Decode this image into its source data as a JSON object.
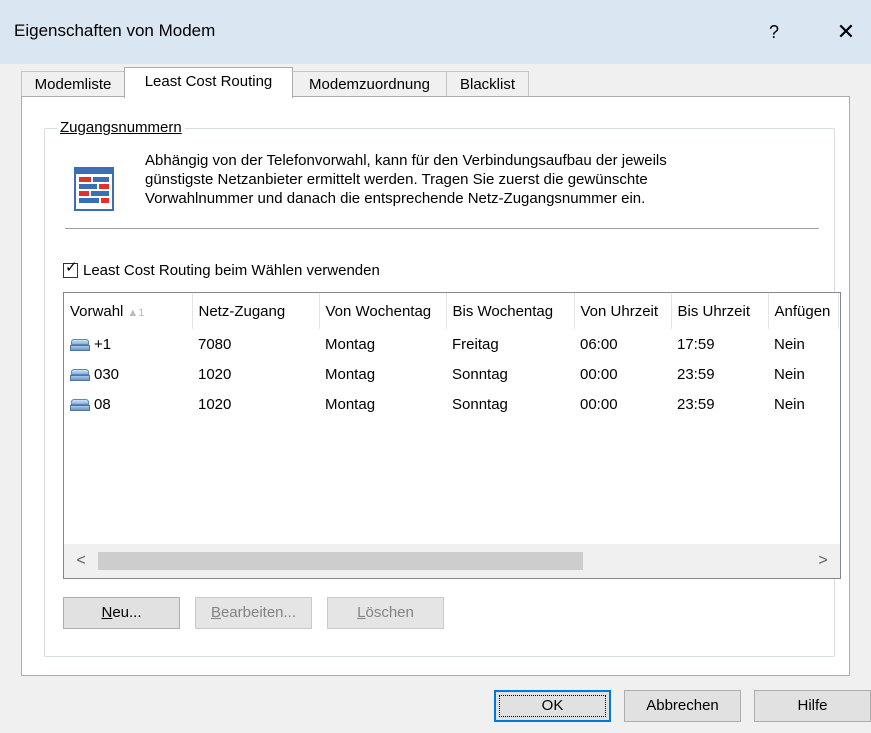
{
  "window": {
    "title": "Eigenschaften von Modem",
    "help_label": "?",
    "close_label": "✕"
  },
  "tabs": [
    {
      "label": "Modemliste",
      "active": false
    },
    {
      "label": "Least Cost Routing",
      "active": true
    },
    {
      "label": "Modemzuordnung",
      "active": false
    },
    {
      "label": "Blacklist",
      "active": false
    }
  ],
  "group": {
    "legend": "Zugangsnummern",
    "info_line1": "Abhängig von der Telefonvorwahl, kann für den Verbindungsaufbau der jeweils",
    "info_line2": "günstigste Netzanbieter ermittelt werden. Tragen Sie zuerst die gewünschte",
    "info_line3": "Vorwahlnummer und danach die entsprechende Netz-Zugangsnummer ein.",
    "checkbox_label": "Least Cost Routing beim Wählen verwenden",
    "checkbox_checked": true
  },
  "table": {
    "columns": [
      "Vorwahl",
      "Netz-Zugang",
      "Von Wochentag",
      "Bis Wochentag",
      "Von Uhrzeit",
      "Bis Uhrzeit",
      "Anfügen"
    ],
    "sort_indicator": "▲1",
    "rows": [
      [
        "+1",
        "7080",
        "Montag",
        "Freitag",
        "06:00",
        "17:59",
        "Nein"
      ],
      [
        "030",
        "1020",
        "Montag",
        "Sonntag",
        "00:00",
        "23:59",
        "Nein"
      ],
      [
        "08",
        "1020",
        "Montag",
        "Sonntag",
        "00:00",
        "23:59",
        "Nein"
      ]
    ]
  },
  "scrollbar": {
    "left_arrow": "<",
    "right_arrow": ">"
  },
  "buttons": {
    "new_prefix": "N",
    "new_rest": "eu...",
    "edit_prefix": "B",
    "edit_rest": "earbeiten...",
    "delete_prefix": "L",
    "delete_rest": "öschen",
    "ok": "OK",
    "cancel": "Abbrechen",
    "help": "Hilfe"
  }
}
